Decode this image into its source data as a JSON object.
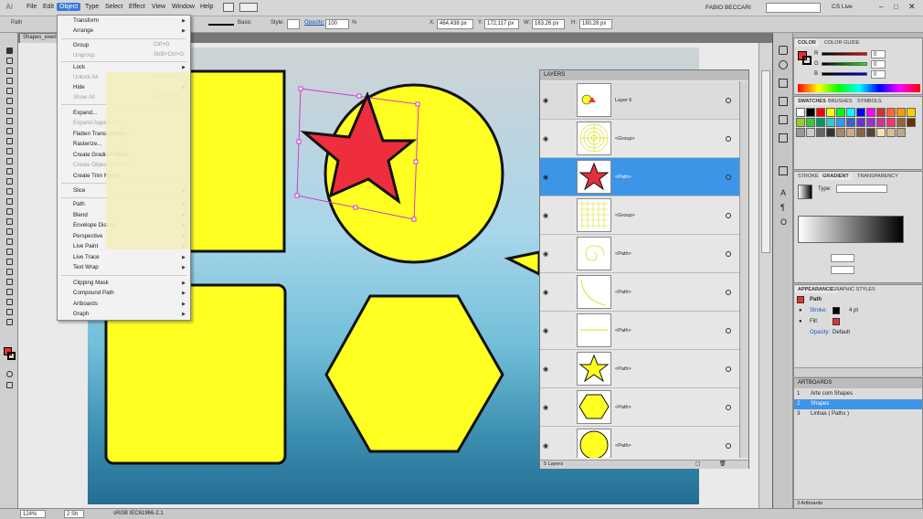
{
  "menubar": {
    "app_icon": "Ai",
    "items": [
      "File",
      "Edit",
      "Object",
      "Type",
      "Select",
      "Effect",
      "View",
      "Window",
      "Help"
    ],
    "user": "FABIO BECCARI",
    "cs_live": "CS Live"
  },
  "control_bar": {
    "selection": "Path",
    "stroke_style": "Basic",
    "style_label": "Style:",
    "opacity_label": "Opacity:",
    "opacity_value": "100",
    "percent": "%",
    "x_label": "X:",
    "x_value": "464,438 px",
    "y_label": "Y:",
    "y_value": "172,117 px",
    "w_label": "W:",
    "w_value": "163,26 px",
    "h_label": "H:",
    "h_value": "180,28 px"
  },
  "document": {
    "tab_title": "Shapes_exem"
  },
  "object_menu": {
    "items": [
      {
        "label": "Transform",
        "shortcut": "",
        "arrow": true,
        "disabled": false
      },
      {
        "label": "Arrange",
        "shortcut": "",
        "arrow": true,
        "disabled": false
      },
      {
        "label": "Group",
        "shortcut": "Ctrl+G",
        "arrow": false,
        "disabled": false
      },
      {
        "label": "Ungroup",
        "shortcut": "Shift+Ctrl+G",
        "arrow": false,
        "disabled": true
      },
      {
        "label": "Lock",
        "shortcut": "",
        "arrow": true,
        "disabled": false
      },
      {
        "label": "Unlock All",
        "shortcut": "Alt+Ctrl+2",
        "arrow": false,
        "disabled": true
      },
      {
        "label": "Hide",
        "shortcut": "",
        "arrow": true,
        "disabled": false
      },
      {
        "label": "Show All",
        "shortcut": "Alt+Ctrl+3",
        "arrow": false,
        "disabled": true
      },
      {
        "label": "Expand...",
        "shortcut": "",
        "arrow": false,
        "disabled": false
      },
      {
        "label": "Expand Appearance",
        "shortcut": "",
        "arrow": false,
        "disabled": true
      },
      {
        "label": "Flatten Transparency...",
        "shortcut": "",
        "arrow": false,
        "disabled": false
      },
      {
        "label": "Rasterize...",
        "shortcut": "",
        "arrow": false,
        "disabled": false
      },
      {
        "label": "Create Gradient Mesh...",
        "shortcut": "",
        "arrow": false,
        "disabled": false
      },
      {
        "label": "Create Object Mosaic...",
        "shortcut": "",
        "arrow": false,
        "disabled": true
      },
      {
        "label": "Create Trim Marks",
        "shortcut": "",
        "arrow": false,
        "disabled": false
      },
      {
        "label": "Slice",
        "shortcut": "",
        "arrow": true,
        "disabled": false
      },
      {
        "label": "Path",
        "shortcut": "",
        "arrow": true,
        "disabled": false
      },
      {
        "label": "Blend",
        "shortcut": "",
        "arrow": true,
        "disabled": false
      },
      {
        "label": "Envelope Distort",
        "shortcut": "",
        "arrow": true,
        "disabled": false
      },
      {
        "label": "Perspective",
        "shortcut": "",
        "arrow": true,
        "disabled": false
      },
      {
        "label": "Live Paint",
        "shortcut": "",
        "arrow": true,
        "disabled": false
      },
      {
        "label": "Live Trace",
        "shortcut": "",
        "arrow": true,
        "disabled": false
      },
      {
        "label": "Text Wrap",
        "shortcut": "",
        "arrow": true,
        "disabled": false
      },
      {
        "label": "Clipping Mask",
        "shortcut": "",
        "arrow": true,
        "disabled": false
      },
      {
        "label": "Compound Path",
        "shortcut": "",
        "arrow": true,
        "disabled": false
      },
      {
        "label": "Artboards",
        "shortcut": "",
        "arrow": true,
        "disabled": false
      },
      {
        "label": "Graph",
        "shortcut": "",
        "arrow": true,
        "disabled": false
      }
    ]
  },
  "layers_panel": {
    "title": "LAYERS",
    "rows": [
      {
        "name": "Layer 6",
        "selected": false,
        "thumb": "layer"
      },
      {
        "name": "<Group>",
        "selected": false,
        "thumb": "circles"
      },
      {
        "name": "<Path>",
        "selected": true,
        "thumb": "star-red"
      },
      {
        "name": "<Group>",
        "selected": false,
        "thumb": "grid"
      },
      {
        "name": "<Path>",
        "selected": false,
        "thumb": "spiral"
      },
      {
        "name": "<Path>",
        "selected": false,
        "thumb": "arc"
      },
      {
        "name": "<Path>",
        "selected": false,
        "thumb": "line"
      },
      {
        "name": "<Path>",
        "selected": false,
        "thumb": "star-yellow"
      },
      {
        "name": "<Path>",
        "selected": false,
        "thumb": "hexagon"
      },
      {
        "name": "<Path>",
        "selected": false,
        "thumb": "circle"
      }
    ],
    "footer": "5 Layers"
  },
  "color_panel": {
    "tabs": [
      "COLOR",
      "COLOR GUIDE"
    ],
    "r": "0",
    "g": "0",
    "b": "0"
  },
  "swatches_panel": {
    "tabs": [
      "SWATCHES",
      "BRUSHES",
      "SYMBOLS"
    ],
    "colors": [
      "#ffffff",
      "#000000",
      "#ff0000",
      "#ffff00",
      "#00ff00",
      "#00ffff",
      "#0000ff",
      "#ff00ff",
      "#cc3333",
      "#ff6633",
      "#ff9900",
      "#ffcc00",
      "#99cc33",
      "#33cc33",
      "#009966",
      "#33cccc",
      "#3399ff",
      "#3366cc",
      "#6633cc",
      "#9933cc",
      "#cc3399",
      "#ff3366",
      "#996633",
      "#663300",
      "#999999",
      "#cccccc",
      "#666666",
      "#333333",
      "#aa8866",
      "#ccaa88",
      "#886644",
      "#554433",
      "#ffddaa",
      "#ddbb99",
      "#bbaa88"
    ]
  },
  "gradient_panel": {
    "tabs": [
      "STROKE",
      "GRADIENT",
      "TRANSPARENCY"
    ],
    "type_label": "Type:"
  },
  "appearance_panel": {
    "tabs": [
      "APPEARANCE",
      "GRAPHIC STYLES"
    ],
    "object": "Path",
    "stroke_label": "Stroke:",
    "stroke_value": "4 pt",
    "fill_label": "Fill:",
    "opacity_label": "Opacity:",
    "opacity_value": "Default"
  },
  "artboards_panel": {
    "title": "ARTBOARDS",
    "rows": [
      {
        "num": "1",
        "name": "Arte com Shapes",
        "selected": false
      },
      {
        "num": "2",
        "name": "Shapes",
        "selected": true
      },
      {
        "num": "3",
        "name": "Linhas ( Paths )",
        "selected": false
      }
    ],
    "footer": "3 Artboards"
  },
  "status_bar": {
    "zoom": "124%",
    "artboard_nav": "2 Sh",
    "profile": "sRGB IEC61966-2.1"
  }
}
